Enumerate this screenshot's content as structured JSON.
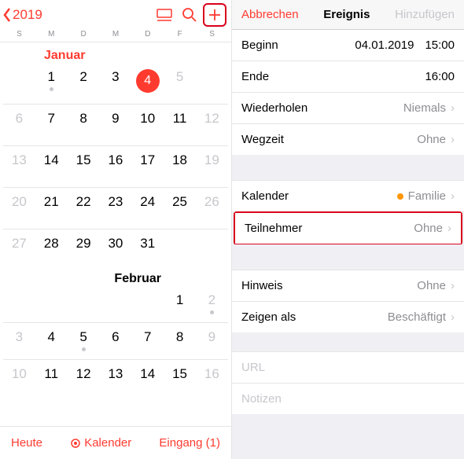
{
  "left": {
    "back_year": "2019",
    "weekdays": [
      "S",
      "M",
      "D",
      "M",
      "D",
      "F",
      "S"
    ],
    "months": {
      "jan": "Januar",
      "feb": "Februar"
    },
    "selected_day": "4",
    "bottom": {
      "today": "Heute",
      "calendars": "Kalender",
      "inbox": "Eingang (1)"
    }
  },
  "right": {
    "header": {
      "cancel": "Abbrechen",
      "title": "Ereignis",
      "add": "Hinzufügen"
    },
    "begin": {
      "label": "Beginn",
      "date": "04.01.2019",
      "time": "15:00"
    },
    "end": {
      "label": "Ende",
      "time": "16:00"
    },
    "repeat": {
      "label": "Wiederholen",
      "value": "Niemals"
    },
    "travel": {
      "label": "Wegzeit",
      "value": "Ohne"
    },
    "calendar": {
      "label": "Kalender",
      "value": "Familie"
    },
    "attendees": {
      "label": "Teilnehmer",
      "value": "Ohne"
    },
    "alert": {
      "label": "Hinweis",
      "value": "Ohne"
    },
    "showas": {
      "label": "Zeigen als",
      "value": "Beschäftigt"
    },
    "url": {
      "placeholder": "URL"
    },
    "notes": {
      "placeholder": "Notizen"
    }
  }
}
